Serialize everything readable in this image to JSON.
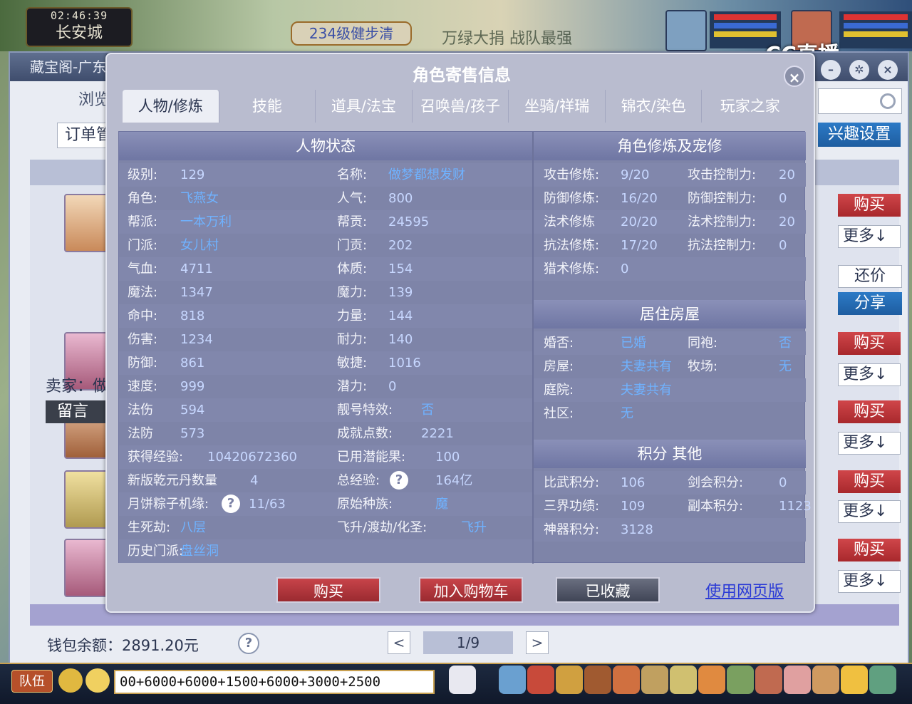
{
  "hud": {
    "time": "02:46:39",
    "city": "长安城",
    "quest_label": "234级健步清",
    "banner": "万绿大捐 战队最强",
    "stream_logo": "CC直播"
  },
  "outer": {
    "title": "藏宝阁-广东",
    "browse": "浏览",
    "order": "订单管",
    "interest": "兴趣设置",
    "seller_label": "卖家：做",
    "msg": "留言",
    "buy": "购买",
    "more": "更多↓",
    "counter": "还价",
    "share": "分享",
    "wallet": "钱包余额：2891.20元",
    "help": "?",
    "prev": "<",
    "next": ">",
    "page": "1/9"
  },
  "modal": {
    "title": "角色寄售信息",
    "close": "×",
    "tabs": [
      "人物/修炼",
      "技能",
      "道具/法宝",
      "召唤兽/孩子",
      "坐骑/祥瑞",
      "锦衣/染色",
      "玩家之家"
    ],
    "sections": {
      "status": "人物状态",
      "cultivation": "角色修炼及宠修",
      "house": "居住房屋",
      "points": "积分 其他"
    },
    "left_col": [
      {
        "label": "级别:",
        "value": "129"
      },
      {
        "label": "角色:",
        "value": "飞燕女"
      },
      {
        "label": "帮派:",
        "value": "一本万利"
      },
      {
        "label": "门派:",
        "value": "女儿村"
      },
      {
        "label": "气血:",
        "value": "4711"
      },
      {
        "label": "魔法:",
        "value": "1347"
      },
      {
        "label": "命中:",
        "value": "818"
      },
      {
        "label": "伤害:",
        "value": "1234"
      },
      {
        "label": "防御:",
        "value": "861"
      },
      {
        "label": "速度:",
        "value": "999"
      },
      {
        "label": "法伤",
        "value": "594"
      },
      {
        "label": "法防",
        "value": "573"
      },
      {
        "label": "获得经验:",
        "value": "10420672360"
      },
      {
        "label": "新版乾元丹数量",
        "value": "4"
      },
      {
        "label": "月饼粽子机缘:",
        "value": "11/63"
      },
      {
        "label": "生死劫:",
        "value": "八层"
      },
      {
        "label": "历史门派:",
        "value": "盘丝洞"
      }
    ],
    "mid_col": [
      {
        "label": "名称:",
        "value": "做梦都想发财"
      },
      {
        "label": "人气:",
        "value": "800"
      },
      {
        "label": "帮贡:",
        "value": "24595"
      },
      {
        "label": "门贡:",
        "value": "202"
      },
      {
        "label": "体质:",
        "value": "154"
      },
      {
        "label": "魔力:",
        "value": "139"
      },
      {
        "label": "力量:",
        "value": "144"
      },
      {
        "label": "耐力:",
        "value": "140"
      },
      {
        "label": "敏捷:",
        "value": "1016"
      },
      {
        "label": "潜力:",
        "value": "0"
      },
      {
        "label": "靓号特效:",
        "value": "否"
      },
      {
        "label": "成就点数:",
        "value": "2221"
      },
      {
        "label": "已用潜能果:",
        "value": "100"
      },
      {
        "label": "总经验:",
        "value": "164亿"
      },
      {
        "label": "原始种族:",
        "value": "魔"
      },
      {
        "label": "飞升/渡劫/化圣:",
        "value": "飞升"
      }
    ],
    "cult": [
      {
        "label": "攻击修炼:",
        "value": "9/20",
        "label2": "攻击控制力:",
        "value2": "20"
      },
      {
        "label": "防御修炼:",
        "value": "16/20",
        "label2": "防御控制力:",
        "value2": "0"
      },
      {
        "label": "法术修炼",
        "value": "20/20",
        "label2": "法术控制力:",
        "value2": "20"
      },
      {
        "label": "抗法修炼:",
        "value": "17/20",
        "label2": "抗法控制力:",
        "value2": "0"
      },
      {
        "label": "猎术修炼:",
        "value": "0"
      }
    ],
    "house": [
      {
        "label": "婚否:",
        "value": "已婚",
        "label2": "同袍:",
        "value2": "否"
      },
      {
        "label": "房屋:",
        "value": "夫妻共有",
        "label2": "牧场:",
        "value2": "无"
      },
      {
        "label": "庭院:",
        "value": "夫妻共有"
      },
      {
        "label": "社区:",
        "value": "无"
      }
    ],
    "points": [
      {
        "label": "比武积分:",
        "value": "106",
        "label2": "剑会积分:",
        "value2": "0"
      },
      {
        "label": "三界功绩:",
        "value": "109",
        "label2": "副本积分:",
        "value2": "1123"
      },
      {
        "label": "神器积分:",
        "value": "3128"
      }
    ],
    "buttons": {
      "buy": "购买",
      "cart": "加入购物车",
      "fav": "已收藏",
      "web": "使用网页版"
    }
  },
  "chat": {
    "team": "队伍",
    "input": "00+6000+6000+1500+6000+3000+2500"
  }
}
